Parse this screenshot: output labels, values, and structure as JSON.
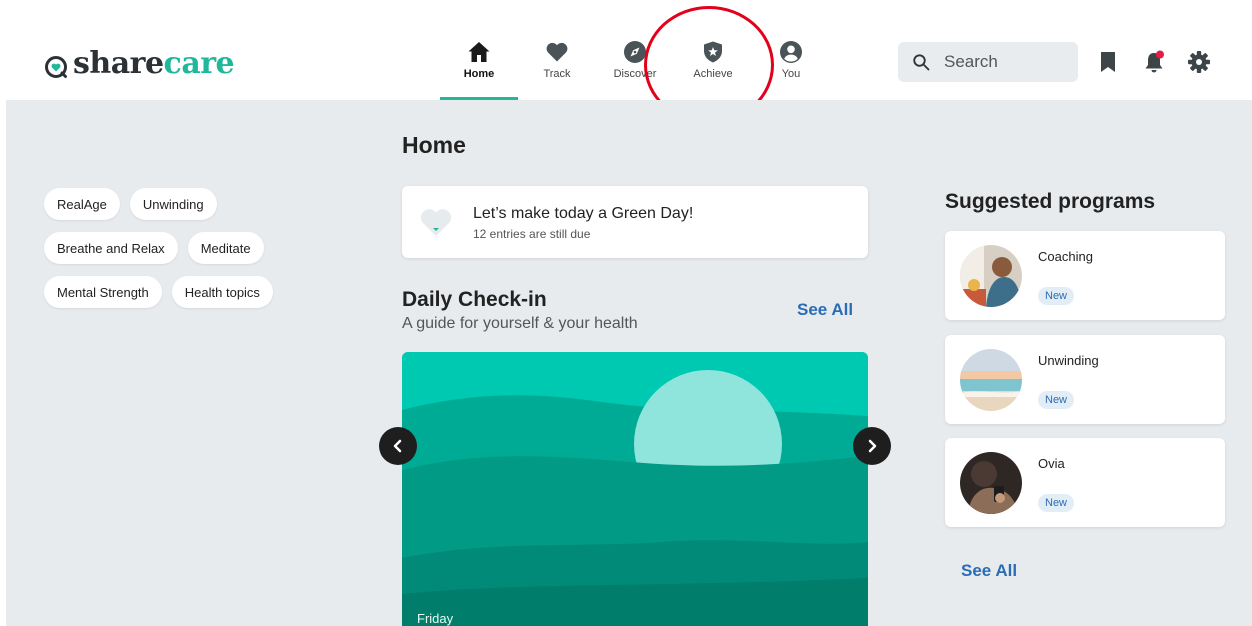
{
  "brand": {
    "part1": "share",
    "part2": "care",
    "accent_color": "#1fb89a"
  },
  "nav": [
    {
      "label": "Home",
      "icon": "home-icon",
      "active": true
    },
    {
      "label": "Track",
      "icon": "heart-icon",
      "active": false
    },
    {
      "label": "Discover",
      "icon": "compass-icon",
      "active": false
    },
    {
      "label": "Achieve",
      "icon": "shield-star-icon",
      "active": false
    },
    {
      "label": "You",
      "icon": "user-circle-icon",
      "active": false
    }
  ],
  "search": {
    "placeholder": "Search"
  },
  "header_icons": [
    "bookmark-icon",
    "bell-icon",
    "gear-icon"
  ],
  "page_title": "Home",
  "chips": [
    [
      "RealAge",
      "Unwinding"
    ],
    [
      "Breathe and Relax",
      "Meditate"
    ],
    [
      "Mental Strength",
      "Health topics"
    ]
  ],
  "green_day": {
    "title": "Let’s make today a Green Day!",
    "subtitle": "12 entries are still due"
  },
  "checkin": {
    "title": "Daily Check-in",
    "subtitle": "A guide for yourself & your health",
    "see_all": "See All",
    "day": "Friday"
  },
  "suggested": {
    "title": "Suggested programs",
    "programs": [
      {
        "name": "Coaching",
        "badge": "New"
      },
      {
        "name": "Unwinding",
        "badge": "New"
      },
      {
        "name": "Ovia",
        "badge": "New"
      }
    ],
    "see_all": "See All"
  }
}
